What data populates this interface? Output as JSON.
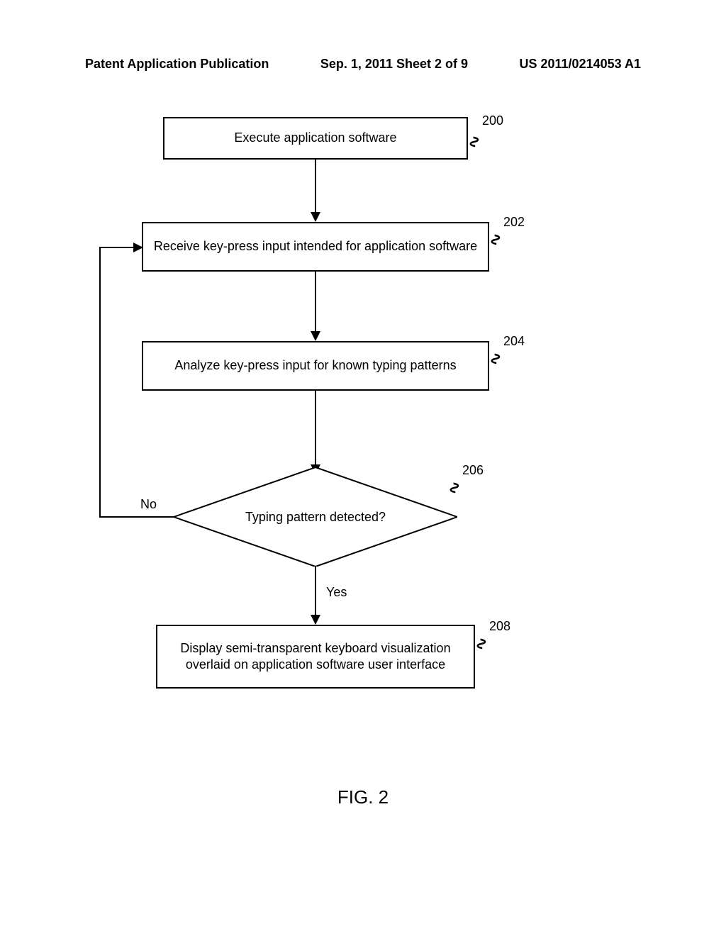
{
  "header": {
    "left": "Patent Application Publication",
    "center": "Sep. 1, 2011  Sheet 2 of 9",
    "right": "US 2011/0214053 A1"
  },
  "steps": {
    "s200": {
      "text": "Execute application software",
      "ref": "200"
    },
    "s202": {
      "text": "Receive key-press input intended for application software",
      "ref": "202"
    },
    "s204": {
      "text": "Analyze key-press input for known typing patterns",
      "ref": "204"
    },
    "s206": {
      "text": "Typing pattern detected?",
      "ref": "206"
    },
    "s208": {
      "text": "Display semi-transparent keyboard visualization overlaid on application software user interface",
      "ref": "208"
    }
  },
  "edges": {
    "no": "No",
    "yes": "Yes"
  },
  "figure_caption": "FIG. 2"
}
